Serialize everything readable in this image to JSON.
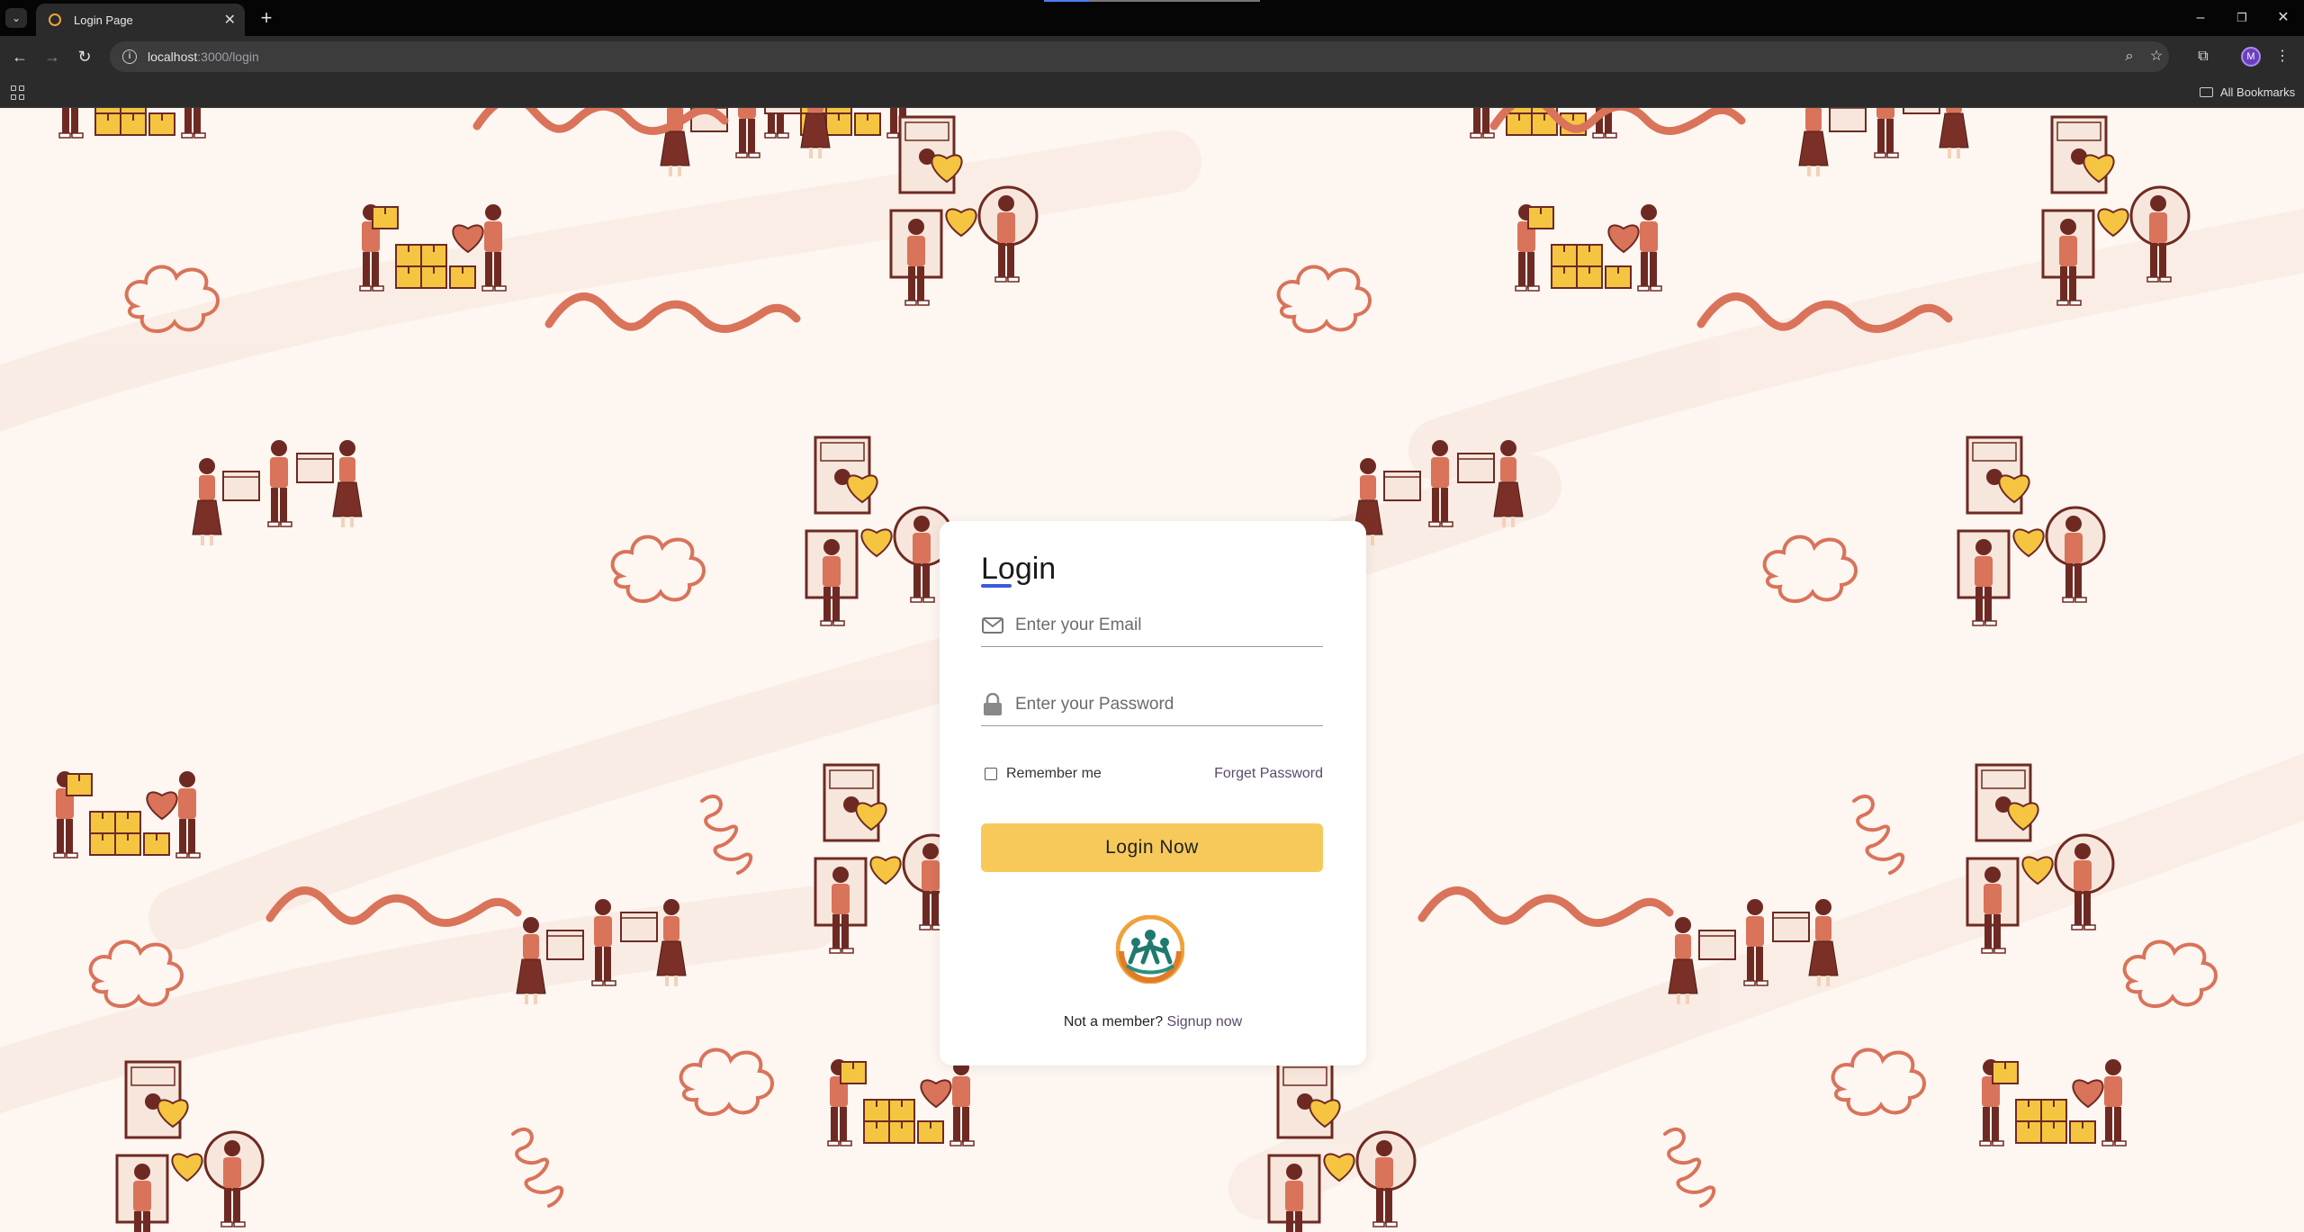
{
  "browser": {
    "tab_title": "Login Page",
    "tab_close": "✕",
    "new_tab": "+",
    "url_host": "localhost",
    "url_path": ":3000/login",
    "bookmarks_label": "All Bookmarks",
    "profile_initial": "M",
    "controls": {
      "minimize": "–",
      "restore": "❐",
      "close": "✕"
    }
  },
  "login": {
    "title": "Login",
    "email_placeholder": "Enter your Email",
    "password_placeholder": "Enter your Password",
    "remember_label": "Remember me",
    "forgot_label": "Forget Password",
    "submit_label": "Login Now",
    "signup_prompt": "Not a member?",
    "signup_link": "Signup now"
  },
  "colors": {
    "accent_button": "#f7c95a",
    "title_underline": "#3b5bdb",
    "page_background": "#fdf6f1",
    "illustration_terracotta": "#d9735a",
    "illustration_yellow": "#f5c542",
    "illustration_maroon": "#6e2a22"
  },
  "icons": {
    "email": "envelope-icon",
    "password": "lock-icon",
    "logo": "community-logo"
  }
}
